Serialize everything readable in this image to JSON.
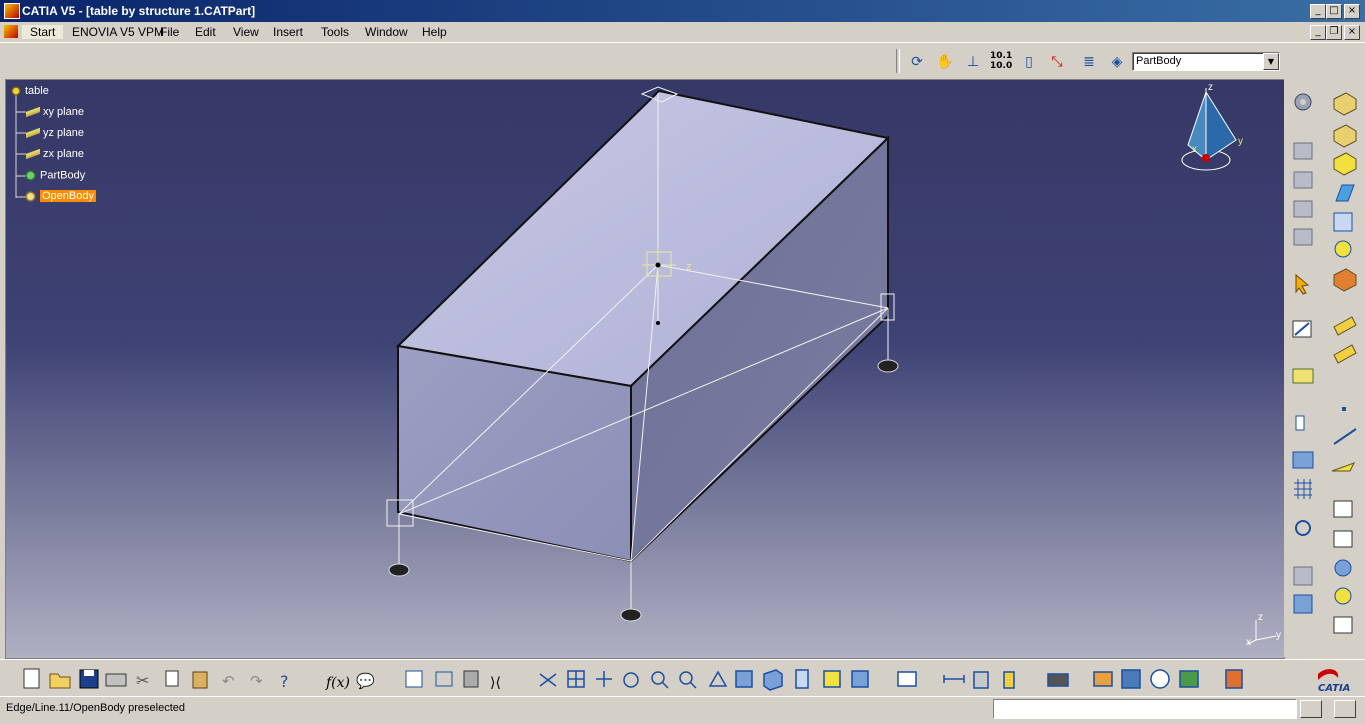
{
  "window": {
    "title": "CATIA V5 - [table by structure 1.CATPart]",
    "controls": [
      "_",
      "□",
      "×"
    ]
  },
  "menubar": {
    "items": [
      {
        "label": "Start"
      },
      {
        "label": "ENOVIA V5 VPM"
      },
      {
        "label": "File"
      },
      {
        "label": "Edit"
      },
      {
        "label": "View"
      },
      {
        "label": "Insert"
      },
      {
        "label": "Tools"
      },
      {
        "label": "Window"
      },
      {
        "label": "Help"
      }
    ],
    "mdi_controls": [
      "_",
      "❐",
      "×"
    ]
  },
  "toolbar_top": {
    "body_select_value": "PartBody",
    "icons": [
      "rotate-icon",
      "pan-hand-icon",
      "axis-icon",
      "number-format-icon",
      "cylinder-icon",
      "tree-icon",
      "list-icon",
      "part-body-icon"
    ],
    "number_icon_text": "10.1\n10.0"
  },
  "tree": {
    "items": [
      {
        "label": "table",
        "icon": "part-icon"
      },
      {
        "label": "xy plane",
        "icon": "plane-icon"
      },
      {
        "label": "yz plane",
        "icon": "plane-icon"
      },
      {
        "label": "zx plane",
        "icon": "plane-icon"
      },
      {
        "label": "PartBody",
        "icon": "gear-icon"
      },
      {
        "label": "OpenBody",
        "icon": "openbody-icon",
        "selected": true
      }
    ]
  },
  "compass": {
    "labels": [
      "z",
      "x",
      "y"
    ]
  },
  "mini_axis": {
    "labels": [
      "z",
      "x",
      "y"
    ]
  },
  "geometry_labels": {
    "point_label": "z"
  },
  "colors": {
    "selection": "#ff8c00",
    "titlebar": "#0a246a",
    "viewport_top": "#363866",
    "viewport_bottom": "#b0b0c3"
  },
  "statusbar": {
    "message": "Edge/Line.11/OpenBody preselected",
    "command_input": ""
  }
}
